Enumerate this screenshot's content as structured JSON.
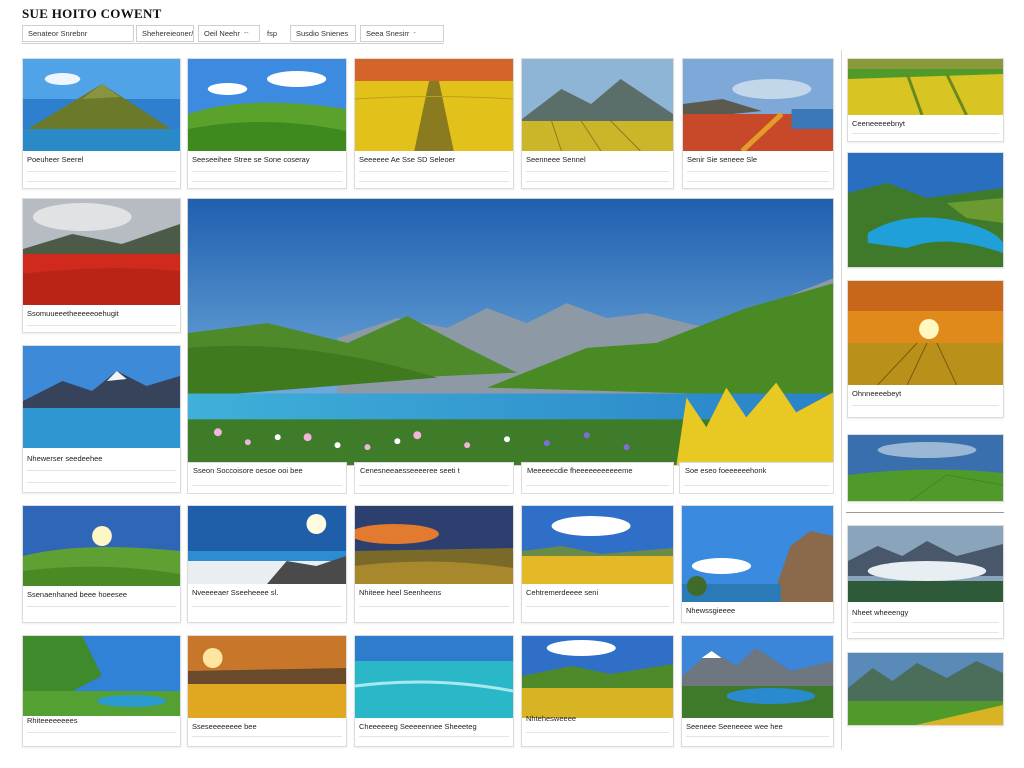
{
  "header": {
    "title": "SUE HOITO COWENT"
  },
  "filters": [
    {
      "label": "Senateor Snrebnr",
      "dropdown": ""
    },
    {
      "label": "Shehereieoner/be",
      "dropdown": ""
    },
    {
      "label": "Oeil Neehr",
      "dropdown": "--"
    },
    {
      "label": "fsp",
      "dropdown": ""
    },
    {
      "label": "Susdio Snienes",
      "dropdown": ""
    },
    {
      "label": "Seea Snesirr",
      "dropdown": "-"
    }
  ],
  "grid_captions": [
    "Poeuheer Seerel",
    "Seeseeihee Stree se Sone coseray",
    "Seeeeee Ae Sse SD Seleoer",
    "Seenneee Sennel",
    "Senir Sie seneee Sle",
    "Ssomuueeetheeeeeoehugit",
    "Nhewerser seedeehee",
    "Ssenaenhaned beee hoeesee",
    "Nveeeeaer Sseeheeee sl.",
    "Nhiteee heel Seenheens",
    "Cehtremerdeeee seni",
    "Nhewssgieeee",
    "Rhiteeeeeeees",
    "Sseseeeeeeee bee",
    "Cheeeeeeg Seeeeennee Sheeeteg",
    "Nhtehesweeee",
    "Seeneee Seeneeee wee hee",
    "Ceeneeeeebnyt",
    "Ohnneeeebeyt",
    "Nheet wheeengy"
  ],
  "featured_captions": [
    "Sseon Soccoisore oesoe ooi bee",
    "Cenesneeaesseeeeree seeti t",
    "Meeeeecdie fheeeeeeeeeeeme",
    "Soe eseo foeeeeeehonk"
  ],
  "icons": {
    "dropdown": "chevron-down-icon"
  },
  "colors": {
    "card_border": "#dcdcdc",
    "divider": "#d6d6d6",
    "title_text": "#111111"
  }
}
